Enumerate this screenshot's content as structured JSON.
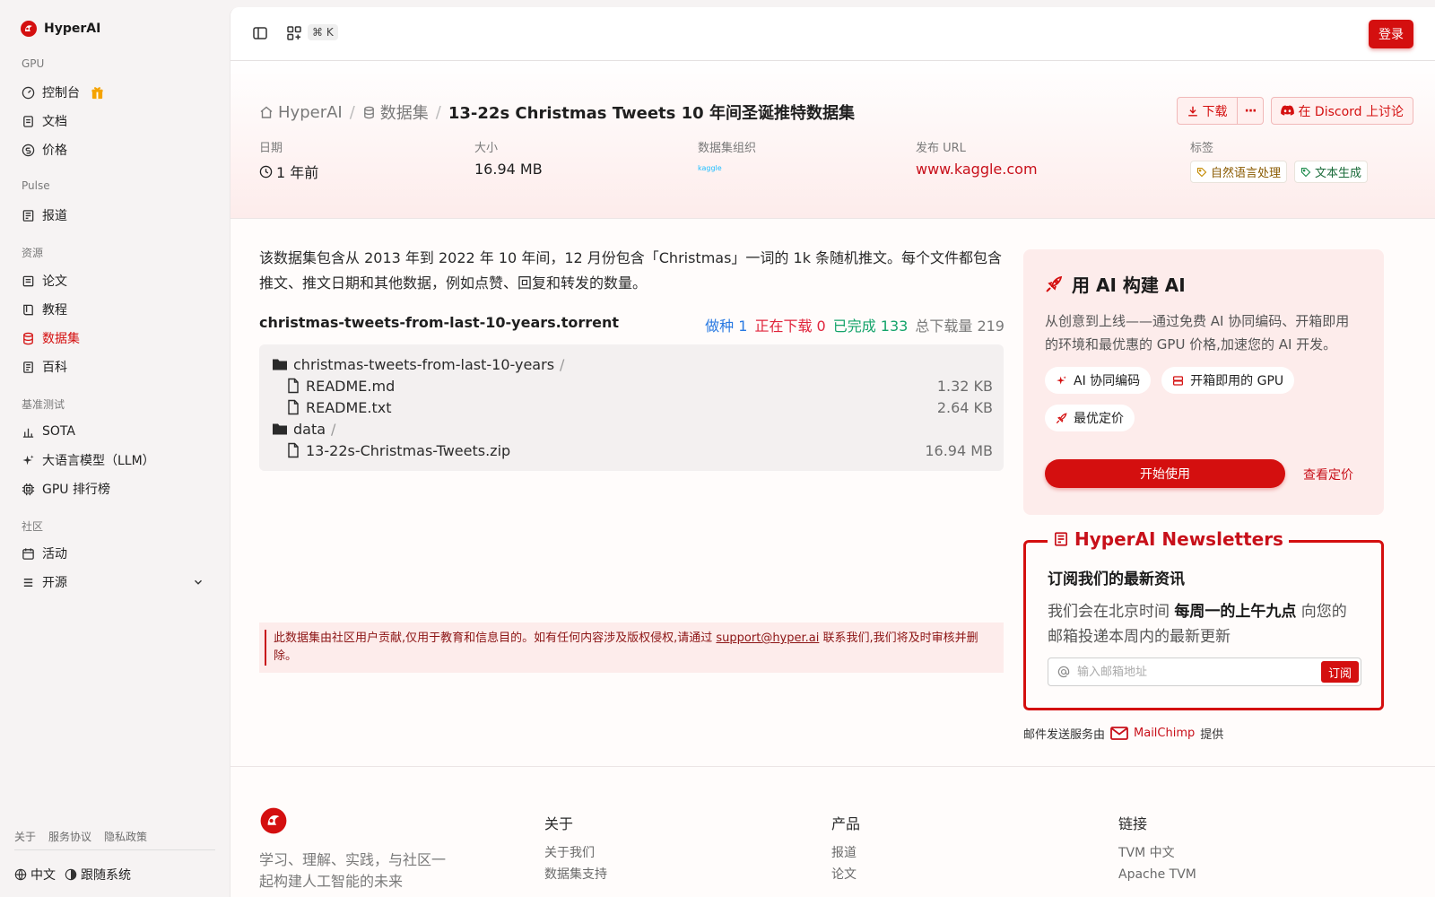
{
  "app": {
    "name": "HyperAI"
  },
  "sidebar": {
    "sections": {
      "gpu": "GPU",
      "pulse": "Pulse",
      "resources": "资源",
      "benchmarks": "基准测试",
      "community": "社区"
    },
    "items": {
      "console": "控制台",
      "docs": "文档",
      "pricing": "价格",
      "news": "报道",
      "papers": "论文",
      "tutorials": "教程",
      "datasets": "数据集",
      "wiki": "百科",
      "sota": "SOTA",
      "llm": "大语言模型（LLM）",
      "gpu_rank": "GPU 排行榜",
      "events": "活动",
      "opensource": "开源"
    },
    "footer_links": [
      "关于",
      "服务协议",
      "隐私政策"
    ],
    "language": "中文",
    "theme": "跟随系统"
  },
  "topbar": {
    "shortcut": "⌘ K",
    "login": "登录"
  },
  "breadcrumb": {
    "home": "HyperAI",
    "datasets": "数据集",
    "current": "13-22s Christmas Tweets 10 年间圣诞推特数据集"
  },
  "actions": {
    "download": "下载",
    "more": "···",
    "discord": "在 Discord 上讨论"
  },
  "meta": {
    "date_label": "日期",
    "date_value": "1 年前",
    "size_label": "大小",
    "size_value": "16.94 MB",
    "org_label": "数据集组织",
    "org_logo_text": "kaggle",
    "url_label": "发布 URL",
    "url_value": "www.kaggle.com",
    "tags_label": "标签",
    "tags": [
      "自然语言处理",
      "文本生成"
    ]
  },
  "description_line1": "该数据集包含从 2013 年到 2022 年 10 年间，12 月份包含「Christmas」一词的 1k 条随机推文。每个文件都包含",
  "description_line2": "推文、推文日期和其他数据，例如点赞、回复和转发的数量。",
  "torrent": {
    "file": "christmas-tweets-from-last-10-years.torrent",
    "seeding": "做种 1",
    "downloading": "正在下载 0",
    "completed": "已完成 133",
    "total": "总下载量 219",
    "files": [
      {
        "name": "christmas-tweets-from-last-10-years",
        "slash": "/",
        "size": ""
      },
      {
        "name": "README.md",
        "slash": "",
        "size": "1.32 KB"
      },
      {
        "name": "README.txt",
        "slash": "",
        "size": "2.64 KB"
      },
      {
        "name": "data",
        "slash": "/",
        "size": ""
      },
      {
        "name": "13-22s-Christmas-Tweets.zip",
        "slash": "",
        "size": "16.94 MB"
      }
    ]
  },
  "notice": {
    "before": "此数据集由社区用户贡献,仅用于教育和信息目的。如有任何内容涉及版权侵权,请通过 ",
    "email": "support@hyper.ai",
    "after": " 联系我们,我们将及时审核并删除。"
  },
  "promo": {
    "title": "用 AI 构建 AI",
    "text": "从创意到上线——通过免费 AI 协同编码、开箱即用的环境和最优惠的 GPU 价格,加速您的 AI 开发。",
    "chips": [
      "AI 协同编码",
      "开箱即用的 GPU",
      "最优定价"
    ],
    "start": "开始使用",
    "pricing_link": "查看定价"
  },
  "newsletter": {
    "legend": "HyperAI Newsletters",
    "subtitle": "订阅我们的最新资讯",
    "text_before": "我们会在北京时间 ",
    "text_bold": "每周一的上午九点",
    "text_after": " 向您的邮箱投递本周内的最新更新",
    "placeholder": "输入邮箱地址",
    "subscribe": "订阅",
    "provider_before": "邮件发送服务由",
    "provider": "MailChimp",
    "provider_after": "提供"
  },
  "footer": {
    "tagline": "学习、理解、实践，与社区一起构建人工智能的未来",
    "col_about": "关于",
    "about_links": [
      "关于我们",
      "数据集支持"
    ],
    "col_products": "产品",
    "product_links": [
      "报道",
      "论文"
    ],
    "col_links": "链接",
    "link_links": [
      "TVM 中文",
      "Apache TVM"
    ]
  },
  "colors": {
    "brand": "#d40f0f",
    "seed": "#2a7ae2",
    "downloading": "#e0243b",
    "completed": "#14a36a"
  }
}
